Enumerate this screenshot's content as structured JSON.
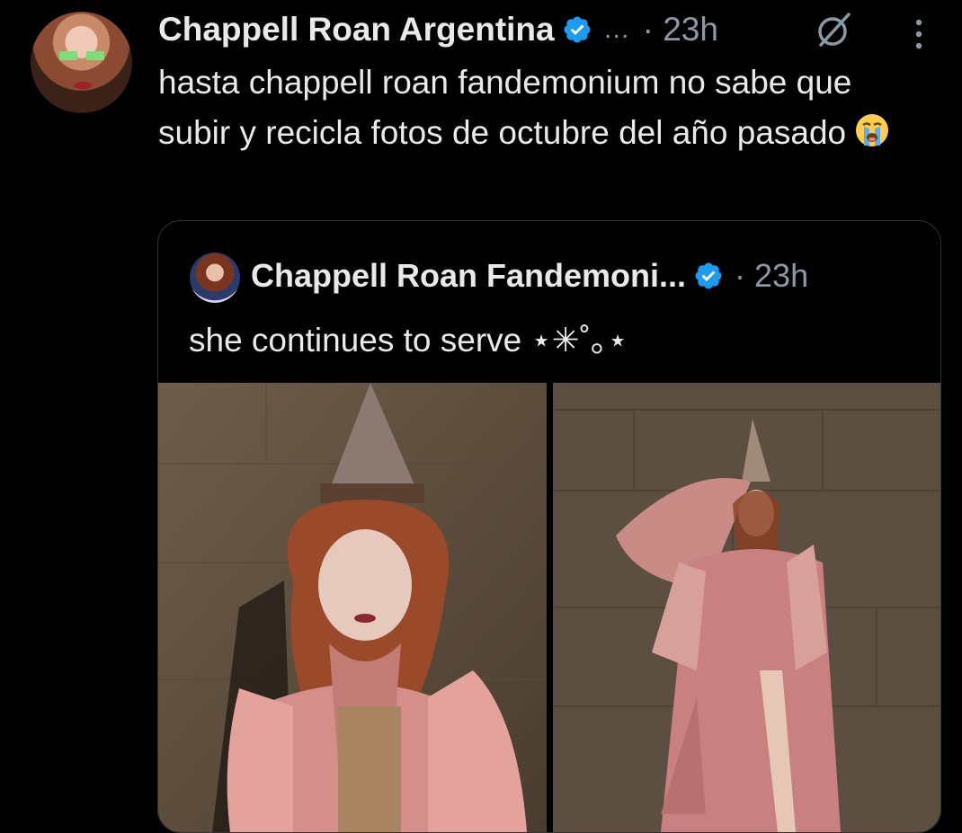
{
  "tweet": {
    "author_name": "Chappell Roan Argentina",
    "ellipsis": "…",
    "time": "· 23h",
    "text": "hasta chappell roan fandemonium no sabe que subir y recicla fotos de octubre del año pasado",
    "emoji": "loudly-crying-face",
    "verified_color": "#1d9bf0"
  },
  "quoted": {
    "author_name": "Chappell Roan Fandemoni...",
    "time": "· 23h",
    "text": "she continues to serve ⋆✳︎˚｡⋆"
  },
  "colors": {
    "background": "#000000",
    "text": "#e7e9ea",
    "secondary": "#8b98a5",
    "border": "#2f3336"
  }
}
